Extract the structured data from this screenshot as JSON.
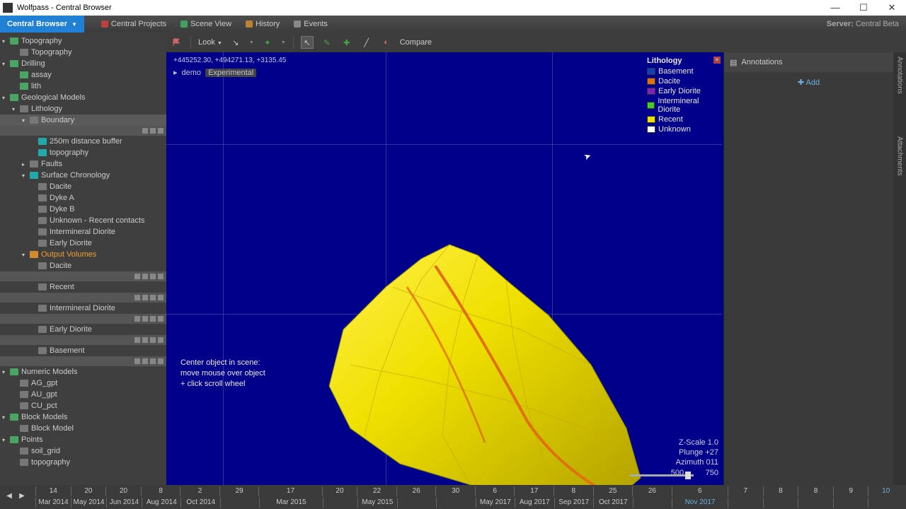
{
  "window": {
    "title": "Wolfpass - Central Browser"
  },
  "tabs": {
    "main": "Central Browser",
    "items": [
      "Central Projects",
      "Scene View",
      "History",
      "Events"
    ],
    "server_lbl": "Server:",
    "server_val": "Central Beta"
  },
  "tree": {
    "topography": "Topography",
    "topography2": "Topography",
    "drilling": "Drilling",
    "assay": "assay",
    "lith": "lith",
    "geo": "Geological Models",
    "lithology": "Lithology",
    "boundary": "Boundary",
    "buf": "250m distance buffer",
    "topo3": "topography",
    "faults": "Faults",
    "surf": "Surface Chronology",
    "dacite": "Dacite",
    "dykea": "Dyke A",
    "dykeb": "Dyke B",
    "unk": "Unknown - Recent contacts",
    "inter": "Intermineral Diorite",
    "early": "Early Diorite",
    "outvol": "Output Volumes",
    "dacite2": "Dacite",
    "recent": "Recent",
    "inter2": "Intermineral Diorite",
    "early2": "Early Diorite",
    "base": "Basement",
    "num": "Numeric Models",
    "ag": "AG_gpt",
    "au": "AU_gpt",
    "cu": "CU_pct",
    "blk": "Block Models",
    "blkm": "Block Model",
    "pts": "Points",
    "soil": "soil_grid",
    "topo4": "topography"
  },
  "toolbar": {
    "look": "Look",
    "compare": "Compare"
  },
  "viewport": {
    "coords": "+445252.30, +494271.13, +3135.45",
    "demo": "demo",
    "exp": "Experimental"
  },
  "legend": {
    "title": "Lithology",
    "items": [
      {
        "c": "#1040c0",
        "n": "Basement"
      },
      {
        "c": "#e07010",
        "n": "Dacite"
      },
      {
        "c": "#8020c0",
        "n": "Early Diorite"
      },
      {
        "c": "#40d020",
        "n": "Intermineral Diorite"
      },
      {
        "c": "#f0e000",
        "n": "Recent"
      },
      {
        "c": "#ffffff",
        "n": "Unknown"
      }
    ]
  },
  "annot": {
    "title": "Annotations",
    "add": "Add"
  },
  "compass": {
    "z": "Z-Scale 1.0",
    "plunge": "Plunge +27",
    "az": "Azimuth 011",
    "lo": "500",
    "hi": "750"
  },
  "overlay": {
    "l1": "Center object in scene:",
    "l2": "move mouse over object",
    "l3": "+ click scroll wheel"
  },
  "timeline": {
    "days": [
      "14",
      "20",
      "20",
      "8",
      "2",
      "29",
      "17",
      "20",
      "22",
      "26",
      "30",
      "6",
      "17",
      "8",
      "25",
      "26",
      "6",
      "7",
      "8",
      "8",
      "9",
      "10"
    ],
    "months": [
      "Mar 2014",
      "May 2014",
      "Jun 2014",
      "Aug 2014",
      "Oct 2014",
      "",
      "Mar 2015",
      "",
      "May 2015",
      "",
      "",
      "May 2017",
      "Aug 2017",
      "Sep 2017",
      "Oct 2017",
      "",
      "Nov 2017",
      "",
      "",
      "",
      "",
      ""
    ]
  },
  "vtabs": {
    "a": "Annotations",
    "b": "Attachments"
  }
}
